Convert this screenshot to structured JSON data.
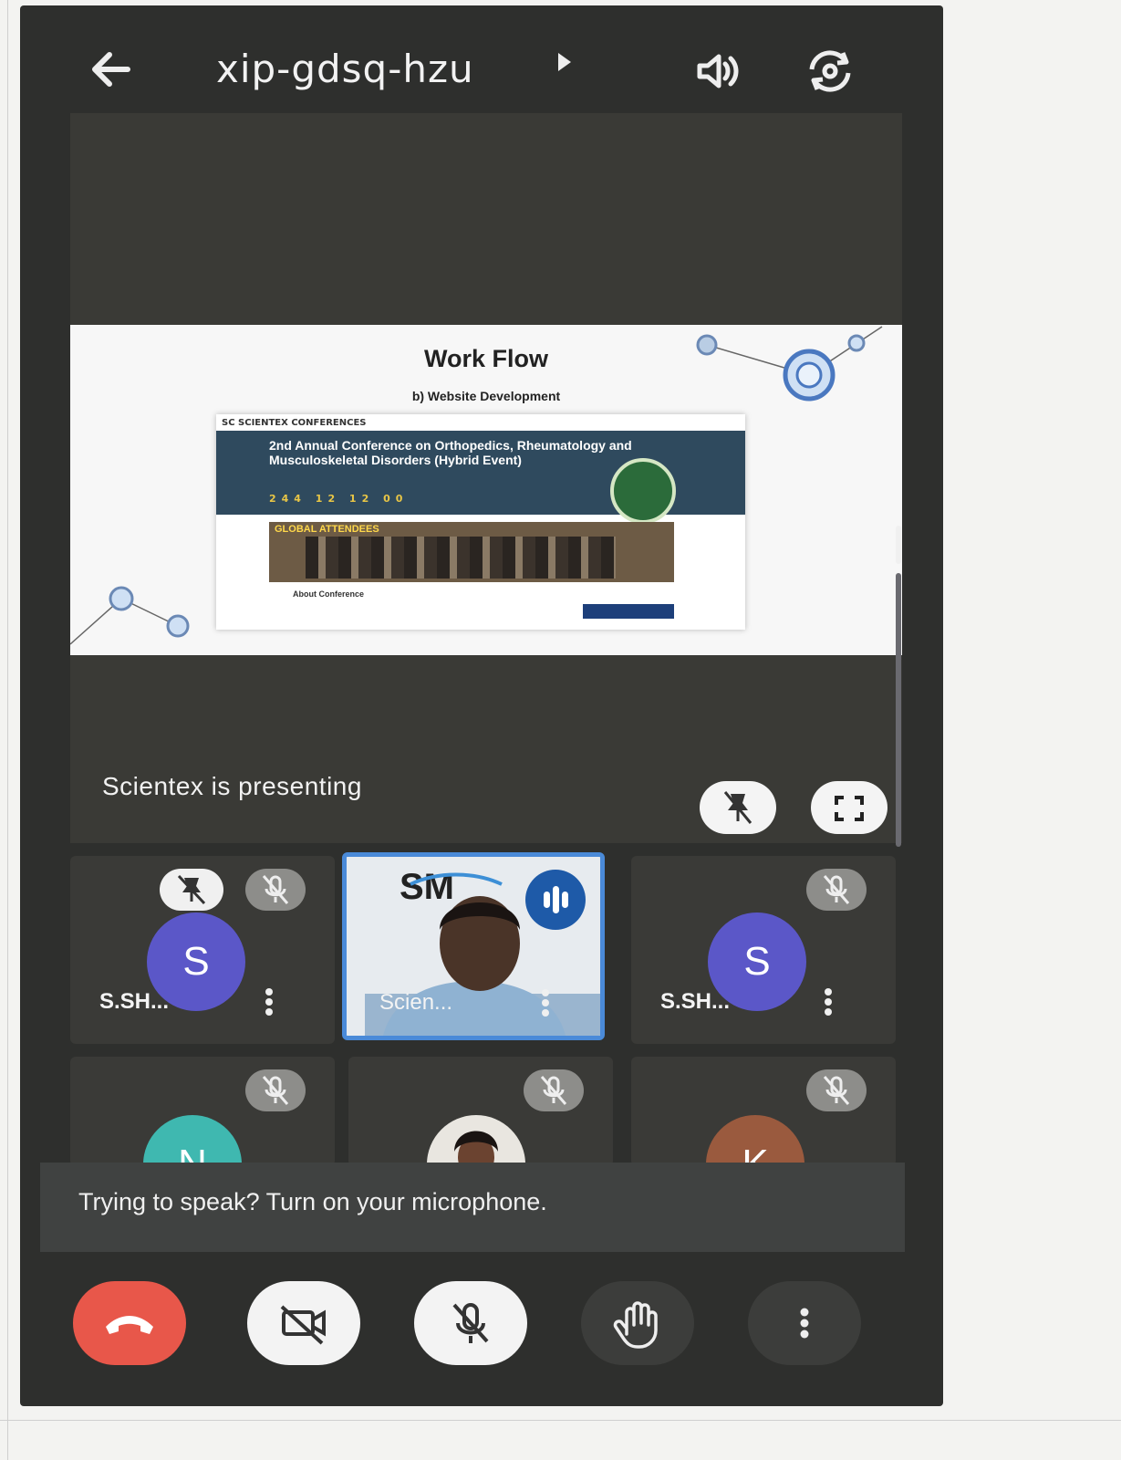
{
  "header": {
    "back_icon": "arrow-left-icon",
    "meeting_code": "xip-gdsq-hzu",
    "speaker_icon": "speaker-icon",
    "switch_camera_icon": "camera-switch-icon"
  },
  "presentation": {
    "slide_title": "Work Flow",
    "slide_subtitle": "b) Website Development",
    "web_logo": "SC SCIENTEX CONFERENCES",
    "web_banner_title": "2nd Annual Conference on Orthopedics, Rheumatology and Musculoskeletal Disorders (Hybrid Event)",
    "web_countdown": "244 12 12 00",
    "web_photo_label": "GLOBAL ATTENDEES",
    "web_about": "About Conference",
    "status_text": "Scientex is presenting",
    "unpin_icon": "unpin-icon",
    "fullscreen_icon": "fullscreen-icon"
  },
  "participants": [
    {
      "initial": "S",
      "name": "S.SH...",
      "color": "#5b57c8",
      "pinned_icon": "unpin-icon",
      "muted": true
    },
    {
      "initial": "",
      "name": "Scien...",
      "logo": "SM",
      "speaking": true
    },
    {
      "initial": "S",
      "name": "S.SH...",
      "color": "#5b57c8",
      "muted": true
    },
    {
      "initial": "N",
      "name": "",
      "color": "#3fb8b0",
      "muted": true
    },
    {
      "initial": "",
      "name": "",
      "photo": true,
      "muted": true
    },
    {
      "initial": "K",
      "name": "",
      "color": "#9a5a3e",
      "muted": true
    }
  ],
  "toast": {
    "text": "Trying to speak? Turn on your microphone."
  },
  "controls": {
    "end_call_icon": "end-call-icon",
    "camera_off_icon": "camera-off-icon",
    "mic_off_icon": "mic-off-icon",
    "raise_hand_icon": "raise-hand-icon",
    "more_icon": "more-vert-icon",
    "end_call_color": "#e8574a"
  }
}
